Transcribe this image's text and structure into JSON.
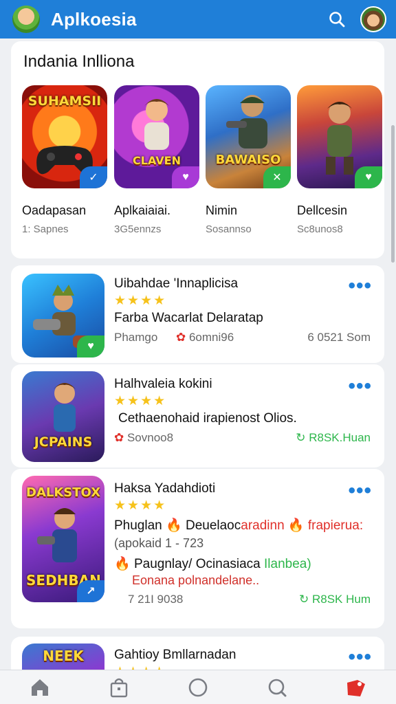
{
  "app": {
    "title": "Aplkoesia"
  },
  "icons": {
    "logo": "app-logo-icon",
    "search": "search-icon",
    "avatar": "user-avatar"
  },
  "colors": {
    "header": "#1f7fd8",
    "accent": "#1f7fd8",
    "star": "#f6c21b",
    "green": "#2db64b",
    "red": "#e0302a"
  },
  "featured": {
    "title": "Indania Inlliona",
    "items": [
      {
        "name": "Oadapasan",
        "sub": "1: Sapnes",
        "art_text": "SUHAMSII"
      },
      {
        "name": "Aplkaiaiai.",
        "sub": "3G5ennzs",
        "art_text": "CLAVEN"
      },
      {
        "name": "Nimin",
        "sub": "Sosannso",
        "art_text": "BAWAISO"
      },
      {
        "name": "Dellcesin",
        "sub": "Sc8unos8",
        "art_text": ""
      }
    ]
  },
  "list": [
    {
      "title": "Uibahdae 'Innaplicisa",
      "stars": "★★★★",
      "line1": "Farba Wacarlat Delaratap",
      "meta_left": "Phamgo",
      "meta_mid": "6omni96",
      "meta_right": "6 0521 Som"
    },
    {
      "title": "Halhvaleia kokini",
      "stars": "★★★★",
      "line1": "Cethaenohaid irapienost Olios.",
      "meta_left": "Sovnoo8",
      "meta_right": "R8SK.Huan",
      "art_text": "JCPAINS"
    },
    {
      "title": "Haksa Yadahdioti",
      "stars": "★★★★",
      "line1a": "Phuglan",
      "line1b": "Deuelaoc",
      "line1c": "aradinn",
      "line1d": "frapierua:",
      "line2": "(apokaid   1 - 723",
      "line3a": "Paugnlay/",
      "line3b": "Ocinasiaca",
      "line3c": "Ilanbea)",
      "line4": "Eonana polnandelane..",
      "meta_left": "7 21I 9038",
      "meta_right": "R8SK Hum",
      "art_top": "DALKSTOX",
      "art_bottom": "SEDHBAN"
    },
    {
      "title": "Gahtioy Bmllarnadan",
      "stars": "★★★★",
      "art_text": "NEEK"
    }
  ],
  "nav": [
    "home-icon",
    "store-bag-icon",
    "circle-icon",
    "search-nav-icon",
    "profile-flag-icon"
  ]
}
